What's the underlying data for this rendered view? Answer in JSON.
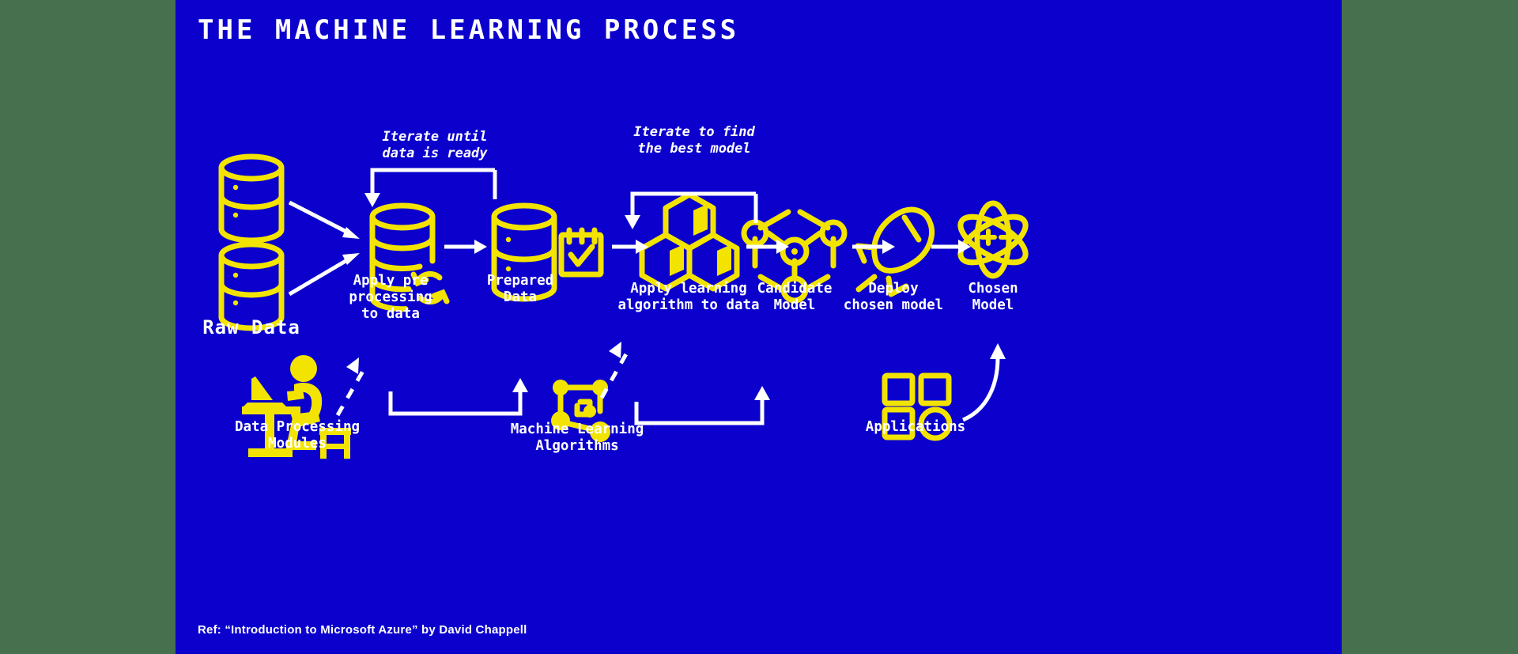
{
  "canvas": {
    "outer_background": "#47704e",
    "slide_background": "#0b00cc",
    "accent_color": "#f2e400",
    "text_color": "#ffffff"
  },
  "header": {
    "title": "THE MACHINE LEARNING PROCESS"
  },
  "footer": {
    "reference": "Ref: “Introduction to Microsoft Azure” by David Chappell"
  },
  "nodes": [
    {
      "id": "raw-data",
      "label": "Raw Data",
      "icon": "database-stack-icon"
    },
    {
      "id": "preprocessing",
      "label": "Apply pre\nprocessing\nto data",
      "icon": "database-refresh-icon"
    },
    {
      "id": "prepared-data",
      "label": "Prepared\nData",
      "icon": "database-check-icon"
    },
    {
      "id": "apply-learning",
      "label": "Apply learning\nalgorithm to data",
      "icon": "hexagon-cluster-icon"
    },
    {
      "id": "candidate-model",
      "label": "Candidate\nModel",
      "icon": "cube-nodes-icon"
    },
    {
      "id": "deploy",
      "label": "Deploy\nchosen model",
      "icon": "rocket-icon"
    },
    {
      "id": "chosen-model",
      "label": "Chosen\nModel",
      "icon": "atom-icon"
    }
  ],
  "resources": [
    {
      "id": "data-processing-modules",
      "label": "Data Processing\nModules",
      "icon": "person-at-desk-icon"
    },
    {
      "id": "ml-algorithms",
      "label": "Machine Learning\nAlgorithms",
      "icon": "node-graph-icon"
    },
    {
      "id": "applications",
      "label": "Applications",
      "icon": "app-grid-icon"
    }
  ],
  "loops": [
    {
      "id": "loop-data",
      "label": "Iterate until\ndata is ready"
    },
    {
      "id": "loop-model",
      "label": "Iterate to find\nthe best model"
    }
  ]
}
